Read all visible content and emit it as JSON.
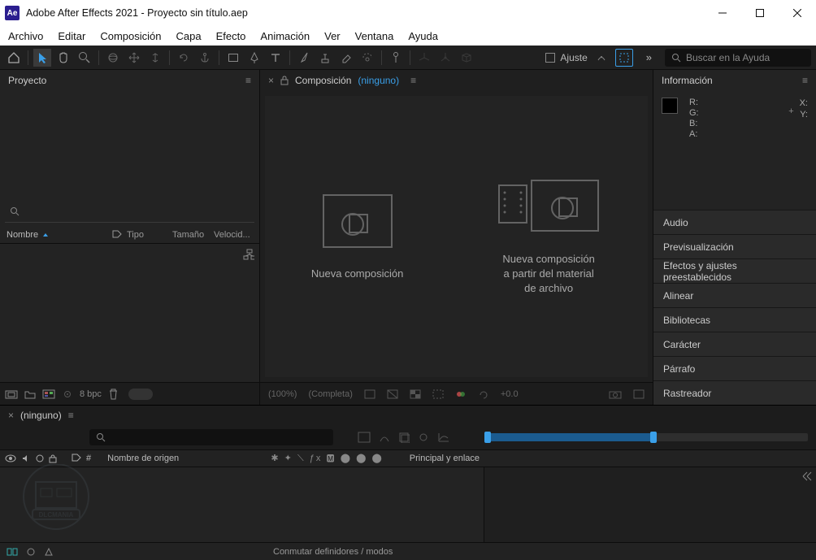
{
  "title": "Adobe After Effects 2021 - Proyecto sin título.aep",
  "app_icon_text": "Ae",
  "menu": [
    "Archivo",
    "Editar",
    "Composición",
    "Capa",
    "Efecto",
    "Animación",
    "Ver",
    "Ventana",
    "Ayuda"
  ],
  "toolbar": {
    "snap_label": "Ajuste",
    "search_placeholder": "Buscar en la Ayuda"
  },
  "project": {
    "title": "Proyecto",
    "search_placeholder": "",
    "cols": {
      "name": "Nombre",
      "type": "Tipo",
      "size": "Tamaño",
      "speed": "Velocid..."
    },
    "bpc": "8 bpc"
  },
  "comp": {
    "title": "Composición",
    "none": "(ninguno)",
    "new_comp": "Nueva composición",
    "new_from_footage_l1": "Nueva composición",
    "new_from_footage_l2": "a partir del material",
    "new_from_footage_l3": "de archivo",
    "zoom": "(100%)",
    "quality": "(Completa)",
    "exposure": "+0.0"
  },
  "right": {
    "info": "Información",
    "labels": {
      "r": "R:",
      "g": "G:",
      "b": "B:",
      "a": "A:",
      "x": "X:",
      "y": "Y:"
    },
    "panels": [
      "Audio",
      "Previsualización",
      "Efectos y ajustes preestablecidos",
      "Alinear",
      "Bibliotecas",
      "Carácter",
      "Párrafo",
      "Rastreador"
    ]
  },
  "timeline": {
    "tab": "(ninguno)",
    "source_name": "Nombre de origen",
    "parent": "Principal y enlace",
    "num": "#",
    "footer": "Conmutar definidores / modos"
  }
}
